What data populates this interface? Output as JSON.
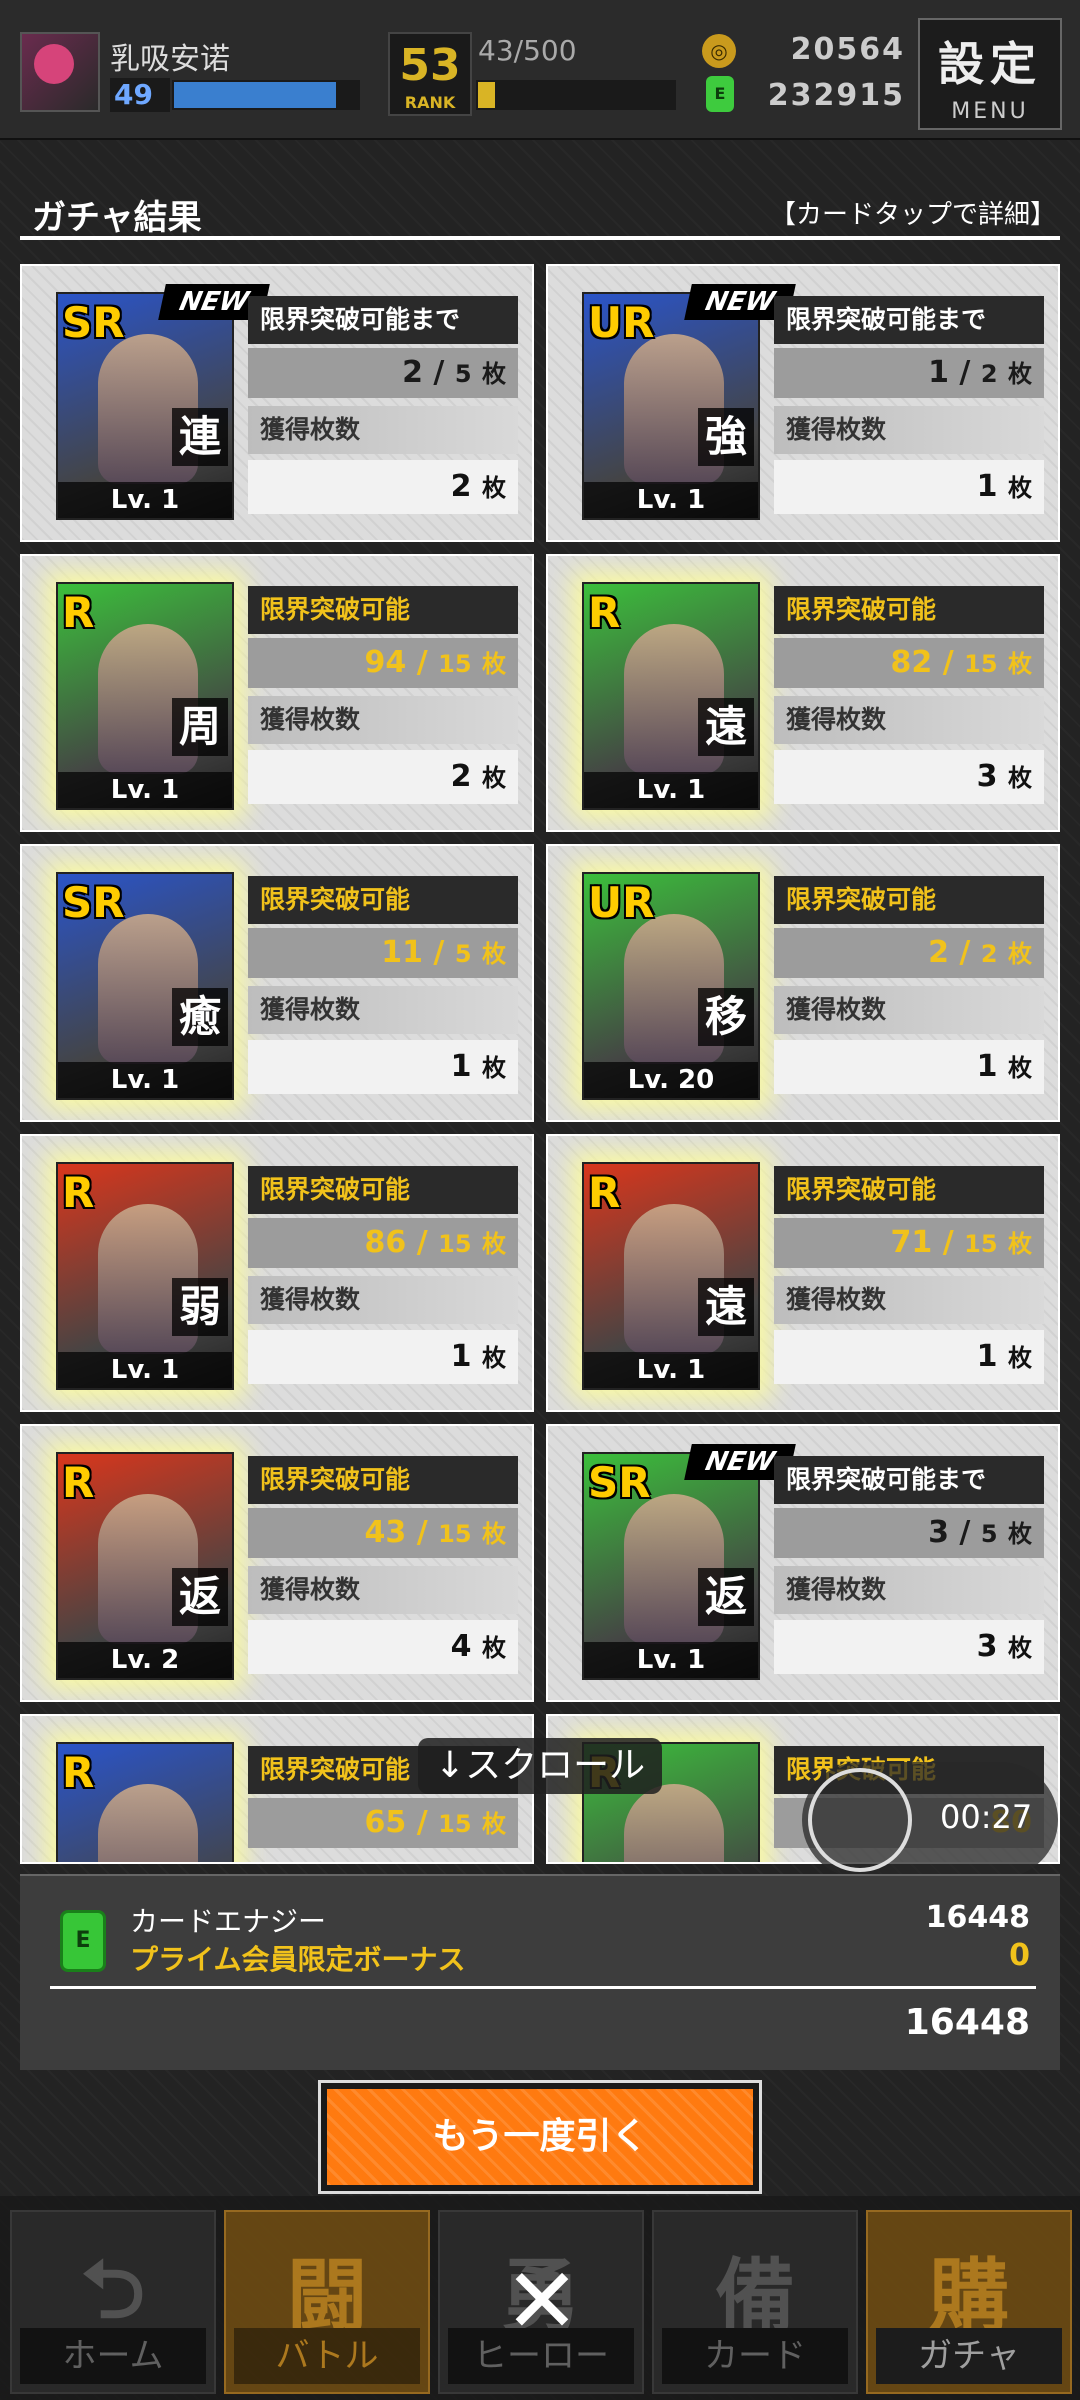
{
  "player": {
    "name": "乳吸安诺",
    "level": "49",
    "exp_fraction": 0.88
  },
  "rank": {
    "value": "53",
    "label": "RANK"
  },
  "stamina": {
    "text": "43/500",
    "fraction": 0.086
  },
  "currency": {
    "coin_icon": "coin-icon",
    "coins": "20564",
    "energy": "232915"
  },
  "settings": {
    "label": "設定",
    "sub": "MENU"
  },
  "header": {
    "title": "ガチャ結果",
    "hint": "【カードタップで詳細】"
  },
  "cards": [
    {
      "rarity": "SR",
      "type": "連",
      "level": "Lv. 1",
      "new": "NEW",
      "row1": "限界突破可能まで",
      "have": "2",
      "need": "5",
      "row3": "獲得枚数",
      "got": "2",
      "unit": "枚",
      "frame": "#2a54c9",
      "glow": false
    },
    {
      "rarity": "UR",
      "type": "強",
      "level": "Lv. 1",
      "new": "NEW",
      "row1": "限界突破可能まで",
      "have": "1",
      "need": "2",
      "row3": "獲得枚数",
      "got": "1",
      "unit": "枚",
      "frame": "#2a54c9",
      "glow": false
    },
    {
      "rarity": "R",
      "type": "周",
      "level": "Lv. 1",
      "new": "",
      "row1": "限界突破可能",
      "have": "94",
      "need": "15",
      "row3": "獲得枚数",
      "got": "2",
      "unit": "枚",
      "frame": "#3bbf3b",
      "glow": true
    },
    {
      "rarity": "R",
      "type": "遠",
      "level": "Lv. 1",
      "new": "",
      "row1": "限界突破可能",
      "have": "82",
      "need": "15",
      "row3": "獲得枚数",
      "got": "3",
      "unit": "枚",
      "frame": "#3bbf3b",
      "glow": true
    },
    {
      "rarity": "SR",
      "type": "癒",
      "level": "Lv. 1",
      "new": "",
      "row1": "限界突破可能",
      "have": "11",
      "need": "5",
      "row3": "獲得枚数",
      "got": "1",
      "unit": "枚",
      "frame": "#2a54c9",
      "glow": true
    },
    {
      "rarity": "UR",
      "type": "移",
      "level": "Lv. 20",
      "new": "",
      "row1": "限界突破可能",
      "have": "2",
      "need": "2",
      "row3": "獲得枚数",
      "got": "1",
      "unit": "枚",
      "frame": "#3bbf3b",
      "glow": true
    },
    {
      "rarity": "R",
      "type": "弱",
      "level": "Lv. 1",
      "new": "",
      "row1": "限界突破可能",
      "have": "86",
      "need": "15",
      "row3": "獲得枚数",
      "got": "1",
      "unit": "枚",
      "frame": "#d9361c",
      "glow": true
    },
    {
      "rarity": "R",
      "type": "遠",
      "level": "Lv. 1",
      "new": "",
      "row1": "限界突破可能",
      "have": "71",
      "need": "15",
      "row3": "獲得枚数",
      "got": "1",
      "unit": "枚",
      "frame": "#d9361c",
      "glow": true
    },
    {
      "rarity": "R",
      "type": "返",
      "level": "Lv. 2",
      "new": "",
      "row1": "限界突破可能",
      "have": "43",
      "need": "15",
      "row3": "獲得枚数",
      "got": "4",
      "unit": "枚",
      "frame": "#d9361c",
      "glow": true
    },
    {
      "rarity": "SR",
      "type": "返",
      "level": "Lv. 1",
      "new": "NEW",
      "row1": "限界突破可能まで",
      "have": "3",
      "need": "5",
      "row3": "獲得枚数",
      "got": "3",
      "unit": "枚",
      "frame": "#3bbf3b",
      "glow": false
    },
    {
      "rarity": "R",
      "type": "",
      "level": "",
      "new": "",
      "row1": "限界突破可能",
      "have": "65",
      "need": "15",
      "row3": "",
      "got": "",
      "unit": "枚",
      "frame": "#2a54c9",
      "glow": true
    },
    {
      "rarity": "R",
      "type": "",
      "level": "",
      "new": "",
      "row1": "限界突破可能",
      "have": "80",
      "need": "",
      "row3": "",
      "got": "",
      "unit": "",
      "frame": "#3bbf3b",
      "glow": true
    }
  ],
  "scroll_hint": "↓スクロール",
  "recording": {
    "time": "00:27"
  },
  "summary": {
    "label1": "カードエナジー",
    "label2": "プライム会員限定ボーナス",
    "value1": "16448",
    "value2": "0",
    "total": "16448",
    "icon": "energy-can-icon"
  },
  "again_button": "もう一度引く",
  "nav": [
    {
      "big": "⮌",
      "label": "ホーム"
    },
    {
      "big": "闘",
      "label": "バトル"
    },
    {
      "big": "勇",
      "label": "ヒーロー"
    },
    {
      "big": "備",
      "label": "カード"
    },
    {
      "big": "購",
      "label": "ガチャ"
    }
  ],
  "close": "✕"
}
